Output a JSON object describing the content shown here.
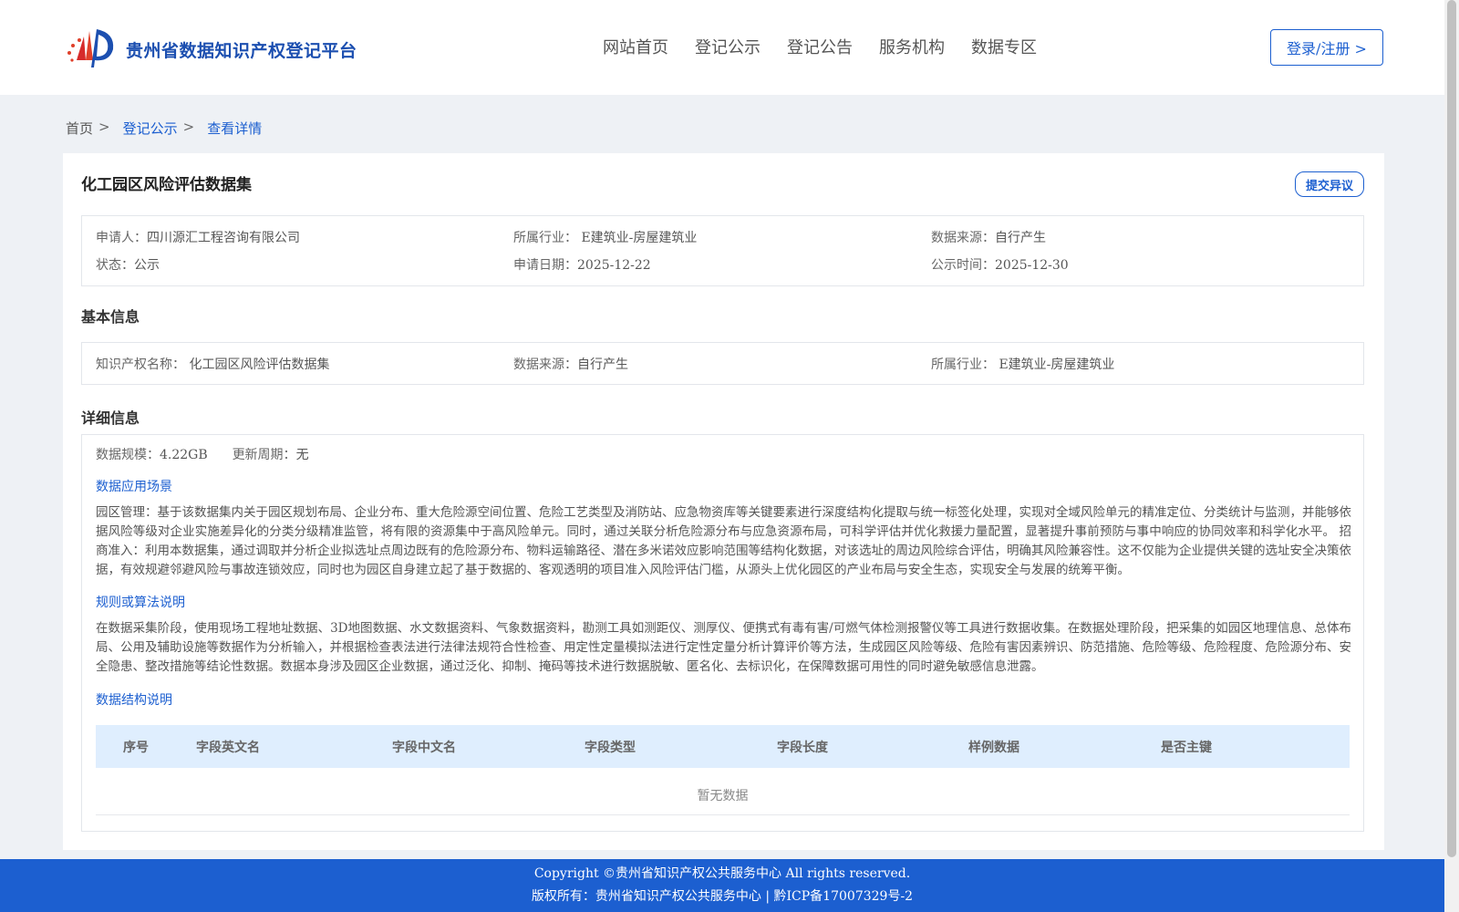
{
  "header": {
    "logo_text": "贵州省数据知识产权登记平台",
    "nav": [
      "网站首页",
      "登记公示",
      "登记公告",
      "服务机构",
      "数据专区"
    ],
    "login_label": "登录/注册 >"
  },
  "breadcrumb": {
    "home": "首页",
    "sep": ">",
    "list": "登记公示",
    "current": "查看详情"
  },
  "detail": {
    "title": "化工园区风险评估数据集",
    "objection_label": "提交异议",
    "summary": {
      "applicant_label": "申请人：",
      "applicant": "四川源汇工程咨询有限公司",
      "industry_label": "所属行业：",
      "industry": "E建筑业-房屋建筑业",
      "source_label": "数据来源：",
      "source": "自行产生",
      "status_label": "状态：",
      "status": "公示",
      "apply_date_label": "申请日期：",
      "apply_date": "2025-12-22",
      "publish_time_label": "公示时间：",
      "publish_time": "2025-12-30"
    },
    "basic": {
      "section_title": "基本信息",
      "ip_name_label": "知识产权名称：",
      "ip_name": "化工园区风险评估数据集",
      "source_label": "数据来源：",
      "source": "自行产生",
      "industry_label": "所属行业：",
      "industry": "E建筑业-房屋建筑业"
    },
    "details": {
      "section_title": "详细信息",
      "scale_label": "数据规模：",
      "scale": "4.22GB",
      "cycle_label": "更新周期：",
      "cycle": "无",
      "scene_title": "数据应用场景",
      "scene_text": "园区管理：基于该数据集内关于园区规划布局、企业分布、重大危险源空间位置、危险工艺类型及消防站、应急物资库等关键要素进行深度结构化提取与统一标签化处理，实现对全域风险单元的精准定位、分类统计与监测，并能够依据风险等级对企业实施差异化的分类分级精准监管，将有限的资源集中于高风险单元。同时，通过关联分析危险源分布与应急资源布局，可科学评估并优化救援力量配置，显著提升事前预防与事中响应的协同效率和科学化水平。 招商准入：利用本数据集，通过调取并分析企业拟选址点周边既有的危险源分布、物料运输路径、潜在多米诺效应影响范围等结构化数据，对该选址的周边风险综合评估，明确其风险兼容性。这不仅能为企业提供关键的选址安全决策依据，有效规避邻避风险与事故连锁效应，同时也为园区自身建立起了基于数据的、客观透明的项目准入风险评估门槛，从源头上优化园区的产业布局与安全生态，实现安全与发展的统筹平衡。",
      "rule_title": "规则或算法说明",
      "rule_text": "在数据采集阶段，使用现场工程地址数据、3D地图数据、水文数据资料、气象数据资料，勘测工具如测距仪、测厚仪、便携式有毒有害/可燃气体检测报警仪等工具进行数据收集。在数据处理阶段，把采集的如园区地理信息、总体布局、公用及辅助设施等数据作为分析输入，并根据检查表法进行法律法规符合性检查、用定性定量模拟法进行定性定量分析计算评价等方法，生成园区风险等级、危险有害因素辨识、防范措施、危险等级、危险程度、危险源分布、安全隐患、整改措施等结论性数据。数据本身涉及园区企业数据，通过泛化、抑制、掩码等技术进行数据脱敏、匿名化、去标识化，在保障数据可用性的同时避免敏感信息泄露。",
      "structure_title": "数据结构说明",
      "table_headers": [
        "序号",
        "字段英文名",
        "字段中文名",
        "字段类型",
        "字段长度",
        "样例数据",
        "是否主键"
      ],
      "empty_text": "暂无数据"
    }
  },
  "footer": {
    "copyright": "Copyright ©贵州省知识产权公共服务中心 All rights reserved.",
    "owner": "版权所有：贵州省知识产权公共服务中心 | 黔ICP备17007329号-2"
  },
  "colors": {
    "brand": "#1c5fd0",
    "footer_bg": "#1c5fd0",
    "page_bg": "#eef1f5",
    "table_head_bg": "#dfeefe"
  },
  "icons": [
    "logo-emblem-icon"
  ]
}
